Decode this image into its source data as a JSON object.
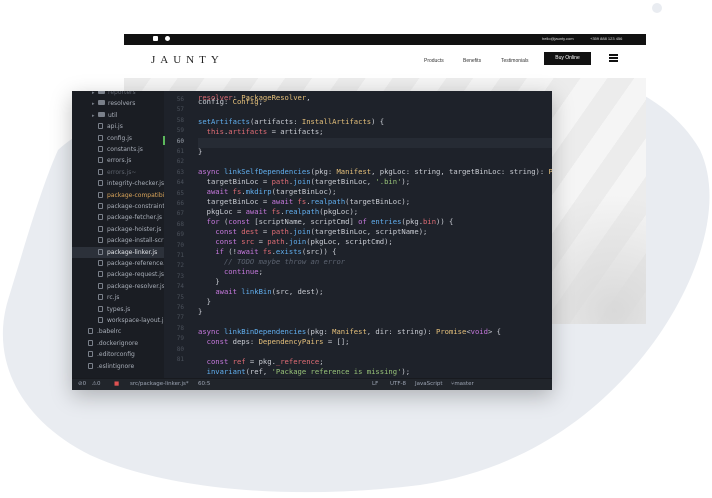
{
  "website": {
    "contact_email": "hello@jaunty.com",
    "contact_phone": "+359 888 123 456",
    "logo": "JAUNTY",
    "nav": [
      "Products",
      "Benefits",
      "Testimonials"
    ],
    "buy_button": "Buy Online"
  },
  "file_tree": [
    {
      "label": "reporters",
      "kind": "folder",
      "depth": 1,
      "state": "dim"
    },
    {
      "label": "resolvers",
      "kind": "folder",
      "depth": 1,
      "state": "normal"
    },
    {
      "label": "util",
      "kind": "folder",
      "depth": 1,
      "state": "normal"
    },
    {
      "label": "api.js",
      "kind": "file",
      "depth": 2,
      "state": "normal"
    },
    {
      "label": "config.js",
      "kind": "file",
      "depth": 2,
      "state": "normal"
    },
    {
      "label": "constants.js",
      "kind": "file",
      "depth": 2,
      "state": "normal"
    },
    {
      "label": "errors.js",
      "kind": "file",
      "depth": 2,
      "state": "normal"
    },
    {
      "label": "errors.js~",
      "kind": "file",
      "depth": 2,
      "state": "dim"
    },
    {
      "label": "integrity-checker.js",
      "kind": "file",
      "depth": 2,
      "state": "normal"
    },
    {
      "label": "package-compatibil",
      "kind": "file",
      "depth": 2,
      "state": "modified"
    },
    {
      "label": "package-constraint",
      "kind": "file",
      "depth": 2,
      "state": "normal"
    },
    {
      "label": "package-fetcher.js",
      "kind": "file",
      "depth": 2,
      "state": "normal"
    },
    {
      "label": "package-hoister.js",
      "kind": "file",
      "depth": 2,
      "state": "normal"
    },
    {
      "label": "package-install-scri",
      "kind": "file",
      "depth": 2,
      "state": "normal"
    },
    {
      "label": "package-linker.js",
      "kind": "file",
      "depth": 2,
      "state": "active"
    },
    {
      "label": "package-reference.",
      "kind": "file",
      "depth": 2,
      "state": "normal"
    },
    {
      "label": "package-request.js",
      "kind": "file",
      "depth": 2,
      "state": "normal"
    },
    {
      "label": "package-resolver.js",
      "kind": "file",
      "depth": 2,
      "state": "normal"
    },
    {
      "label": "rc.js",
      "kind": "file",
      "depth": 2,
      "state": "normal"
    },
    {
      "label": "types.js",
      "kind": "file",
      "depth": 2,
      "state": "normal"
    },
    {
      "label": "workspace-layout.js",
      "kind": "file",
      "depth": 2,
      "state": "normal"
    },
    {
      "label": ".babelrc",
      "kind": "file",
      "depth": 0,
      "state": "normal"
    },
    {
      "label": ".dockerignore",
      "kind": "file",
      "depth": 0,
      "state": "normal"
    },
    {
      "label": ".editorconfig",
      "kind": "file",
      "depth": 0,
      "state": "normal"
    },
    {
      "label": ".eslintignore",
      "kind": "file",
      "depth": 0,
      "state": "normal"
    }
  ],
  "line_numbers": [
    "56",
    "57",
    "58",
    "59",
    "60",
    "61",
    "62",
    "63",
    "64",
    "65",
    "66",
    "67",
    "68",
    "69",
    "70",
    "71",
    "72",
    "73",
    "74",
    "75",
    "76",
    "77",
    "78",
    "79",
    "80",
    "81"
  ],
  "current_line": "60",
  "status": {
    "errors": "0",
    "warnings": "0",
    "file_path": "src/package-linker.js*",
    "cursor": "60:5",
    "line_ending": "LF",
    "encoding": "UTF-8",
    "language": "JavaScript",
    "branch": "master"
  },
  "colors": {
    "editor_bg": "#1e222a",
    "keyword": "#c678dd",
    "function": "#61afef",
    "type": "#e5c07b",
    "string": "#98c379",
    "property": "#e06c75",
    "comment": "#5c6370"
  }
}
